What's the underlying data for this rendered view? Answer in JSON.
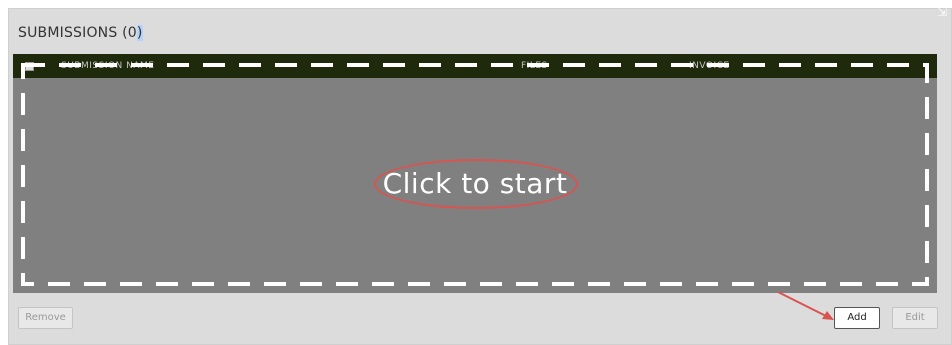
{
  "panel": {
    "title_prefix": "SUBMISSIONS (",
    "title_count": "0",
    "title_suffix": ")"
  },
  "grid": {
    "columns": [
      "SUBMISSION NAME",
      "FILES",
      "INVOICE"
    ],
    "empty_action": "Click to start"
  },
  "buttons": {
    "remove": "Remove",
    "add": "Add",
    "edit": "Edit"
  },
  "colors": {
    "annotation": "#d9534f",
    "header_bg": "#1f2a0c",
    "grid_bg": "#808080",
    "panel_bg": "#dcdcdc"
  }
}
